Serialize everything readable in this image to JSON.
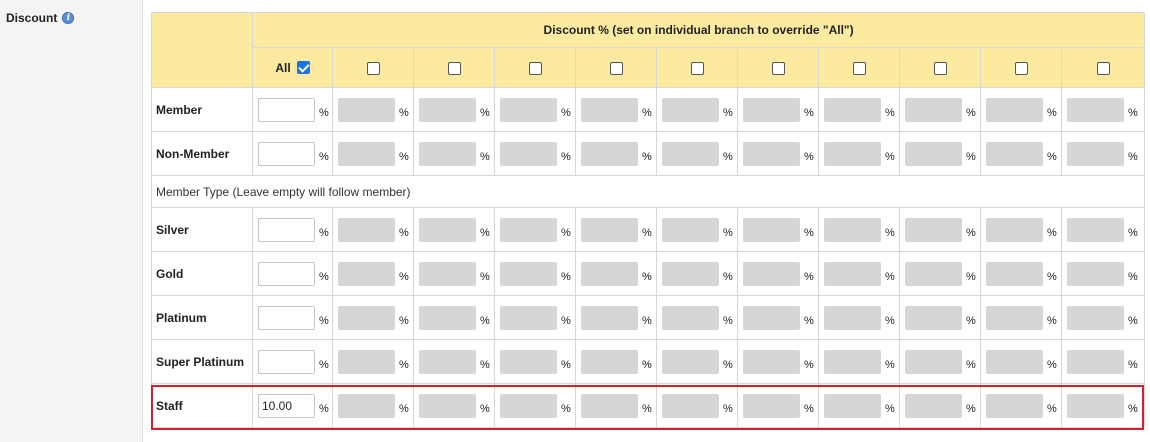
{
  "section": {
    "label": "Discount",
    "info_icon": "info-icon"
  },
  "header": {
    "title": "Discount % (set on individual branch to override \"All\")",
    "all_label": "All",
    "all_checked": true,
    "branch_columns": 10
  },
  "percent_sign": "%",
  "member_type_note": "Member Type (Leave empty will follow member)",
  "rows_top": [
    {
      "label": "Member",
      "all_value": ""
    },
    {
      "label": "Non-Member",
      "all_value": ""
    }
  ],
  "rows_member_types": [
    {
      "label": "Silver",
      "all_value": ""
    },
    {
      "label": "Gold",
      "all_value": ""
    },
    {
      "label": "Platinum",
      "all_value": ""
    },
    {
      "label": "Super Platinum",
      "all_value": ""
    },
    {
      "label": "Staff",
      "all_value": "10.00",
      "highlighted": true
    }
  ],
  "colors": {
    "header_bg": "#fbeaa0",
    "highlight_border": "#d62029",
    "checkbox_checked": "#1a73e8",
    "disabled_input": "#d6d6d6"
  }
}
